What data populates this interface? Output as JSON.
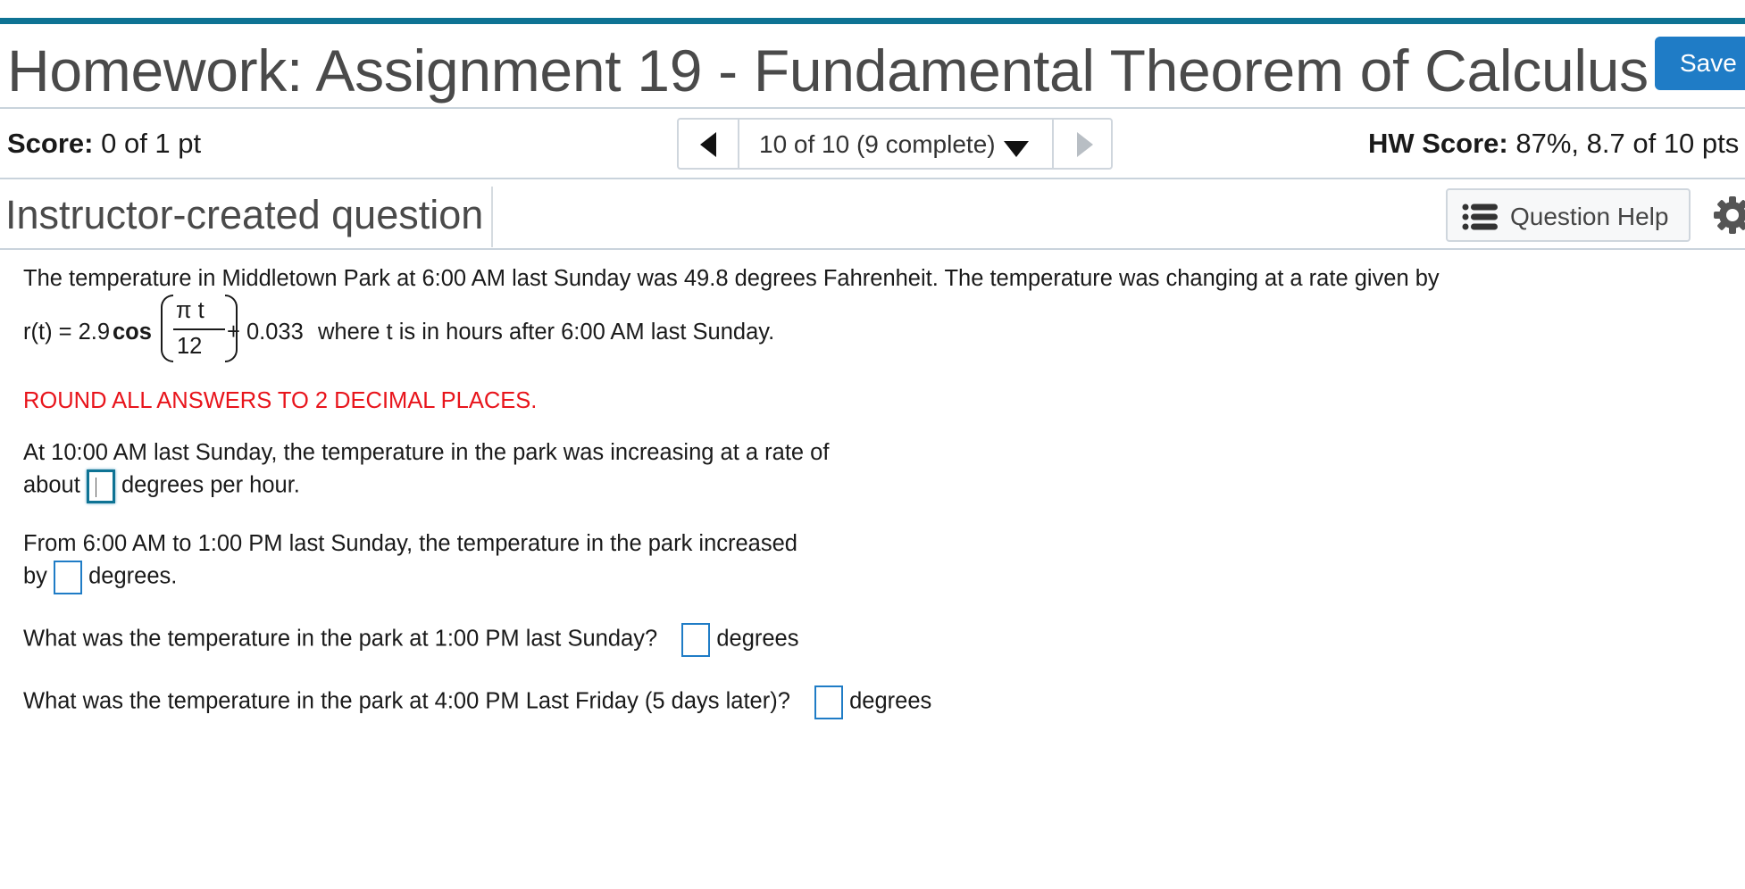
{
  "header": {
    "title": "Homework: Assignment 19 - Fundamental Theorem of Calculus",
    "save_label": "Save"
  },
  "score_bar": {
    "score_label": "Score:",
    "score_value": "0 of 1 pt",
    "pager_label": "10 of 10 (9 complete)",
    "hw_score_label": "HW Score:",
    "hw_score_value": "87%, 8.7 of 10 pts"
  },
  "question_bar": {
    "title": "Instructor-created question",
    "help_label": "Question Help"
  },
  "question": {
    "intro": "The temperature in Middletown Park at 6:00 AM last Sunday was 49.8 degrees Fahrenheit.  The temperature was changing at a rate given by",
    "formula_lhs": "r(t) = 2.9",
    "formula_func": "cos",
    "formula_num": "π t",
    "formula_den": "12",
    "formula_rhs": "+ 0.033",
    "formula_tail": "where t is in hours after 6:00 AM last Sunday.",
    "instruction": "ROUND ALL ANSWERS TO 2 DECIMAL PLACES.",
    "p1_line1": "At 10:00 AM last Sunday, the temperature in the park was increasing at a rate of",
    "p1_pre": "about",
    "p1_post": "degrees per hour.",
    "p2_line1": "From 6:00 AM to 1:00 PM last Sunday, the temperature in the park increased",
    "p2_pre": "by",
    "p2_post": "degrees.",
    "p3_text": "What was the temperature in the park at 1:00 PM last Sunday?",
    "p3_post": "degrees",
    "p4_text": "What was the temperature in the park at 4:00 PM Last Friday (5 days later)?",
    "p4_post": "degrees"
  },
  "colors": {
    "accent": "#0e7394",
    "save_button": "#1f7cc6",
    "instruction": "#e8141b"
  },
  "icons": [
    "triangle-left-icon",
    "caret-down-icon",
    "triangle-right-icon",
    "list-icon",
    "gear-icon"
  ]
}
